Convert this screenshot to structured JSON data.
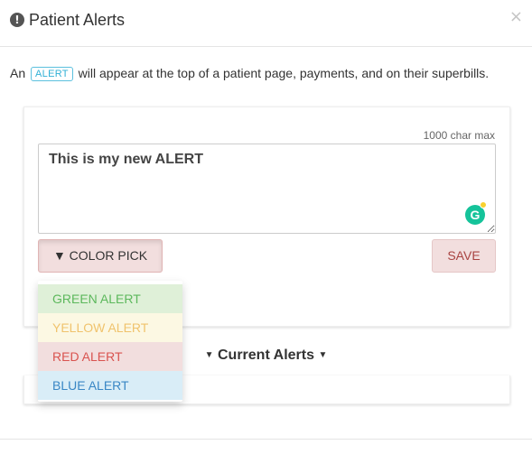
{
  "modal": {
    "title": "Patient Alerts",
    "close_label": "×",
    "header_icon_glyph": "!"
  },
  "intro": {
    "prefix": "An",
    "tag": "ALERT",
    "suffix": "will appear at the top of a patient page, payments, and on their superbills."
  },
  "editor": {
    "char_limit_label": "1000 char max",
    "text_value": "This is my new ALERT",
    "grammarly_glyph": "G"
  },
  "buttons": {
    "color_pick_label": "▼ COLOR PICK",
    "save_label": "SAVE"
  },
  "color_options": [
    {
      "label": "GREEN ALERT",
      "text_color": "#5cb85c",
      "bg_color": "#dff0d8"
    },
    {
      "label": "YELLOW ALERT",
      "text_color": "#f0c36d",
      "bg_color": "#fcf8e3"
    },
    {
      "label": "RED ALERT",
      "text_color": "#d9534f",
      "bg_color": "#f2dede"
    },
    {
      "label": "BLUE ALERT",
      "text_color": "#3a87c5",
      "bg_color": "#d9edf7"
    }
  ],
  "current_alerts": {
    "label": "Current Alerts",
    "caret": "▼"
  },
  "colors": {
    "accent_info": "#5bc0de",
    "danger_text": "#a94442",
    "danger_bg": "#f2dede"
  }
}
